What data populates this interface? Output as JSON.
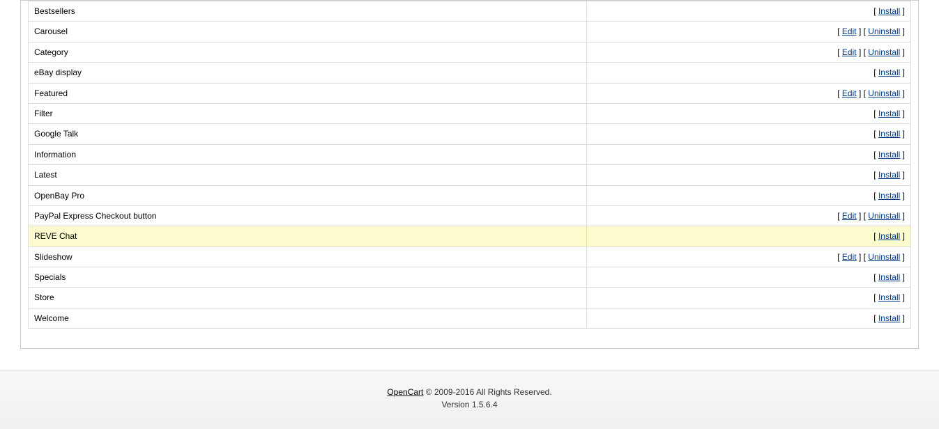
{
  "actions": {
    "install": "Install",
    "edit": "Edit",
    "uninstall": "Uninstall"
  },
  "modules": [
    {
      "name": "Bestsellers",
      "installed": false,
      "highlight": false
    },
    {
      "name": "Carousel",
      "installed": true,
      "highlight": false
    },
    {
      "name": "Category",
      "installed": true,
      "highlight": false
    },
    {
      "name": "eBay display",
      "installed": false,
      "highlight": false
    },
    {
      "name": "Featured",
      "installed": true,
      "highlight": false
    },
    {
      "name": "Filter",
      "installed": false,
      "highlight": false
    },
    {
      "name": "Google Talk",
      "installed": false,
      "highlight": false
    },
    {
      "name": "Information",
      "installed": false,
      "highlight": false
    },
    {
      "name": "Latest",
      "installed": false,
      "highlight": false
    },
    {
      "name": "OpenBay Pro",
      "installed": false,
      "highlight": false
    },
    {
      "name": "PayPal Express Checkout button",
      "installed": true,
      "highlight": false
    },
    {
      "name": "REVE Chat",
      "installed": false,
      "highlight": true
    },
    {
      "name": "Slideshow",
      "installed": true,
      "highlight": false
    },
    {
      "name": "Specials",
      "installed": false,
      "highlight": false
    },
    {
      "name": "Store",
      "installed": false,
      "highlight": false
    },
    {
      "name": "Welcome",
      "installed": false,
      "highlight": false
    }
  ],
  "footer": {
    "brand": "OpenCart",
    "copyright": " © 2009-2016 All Rights Reserved.",
    "version": "Version 1.5.6.4"
  }
}
